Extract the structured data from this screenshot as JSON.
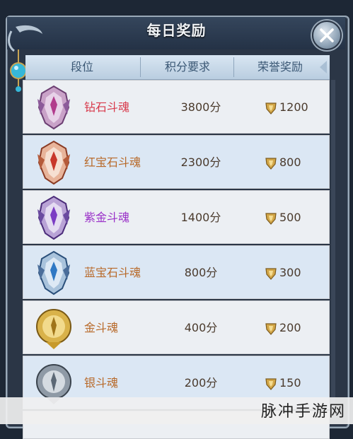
{
  "dialog": {
    "title": "每日奖励"
  },
  "header": {
    "col_rank": "段位",
    "col_points": "积分要求",
    "col_reward": "荣誉奖励"
  },
  "rows": [
    {
      "name": "钻石斗魂",
      "points": "3800分",
      "reward": "1200",
      "name_color": "#d8394b",
      "tier": "diamond"
    },
    {
      "name": "红宝石斗魂",
      "points": "2300分",
      "reward": "800",
      "name_color": "#b86a2a",
      "tier": "ruby"
    },
    {
      "name": "紫金斗魂",
      "points": "1400分",
      "reward": "500",
      "name_color": "#9a30c8",
      "tier": "purple-gold"
    },
    {
      "name": "蓝宝石斗魂",
      "points": "800分",
      "reward": "300",
      "name_color": "#b86a2a",
      "tier": "sapphire"
    },
    {
      "name": "金斗魂",
      "points": "400分",
      "reward": "200",
      "name_color": "#b86a2a",
      "tier": "gold"
    },
    {
      "name": "银斗魂",
      "points": "200分",
      "reward": "150",
      "name_color": "#b86a2a",
      "tier": "silver"
    }
  ],
  "watermark": {
    "text": "脉冲手游网"
  },
  "colors": {
    "accent_blue": "#3b5875",
    "row_light": "#eceff3",
    "row_blue": "#dbe7f4",
    "frame": "#2b3646"
  }
}
